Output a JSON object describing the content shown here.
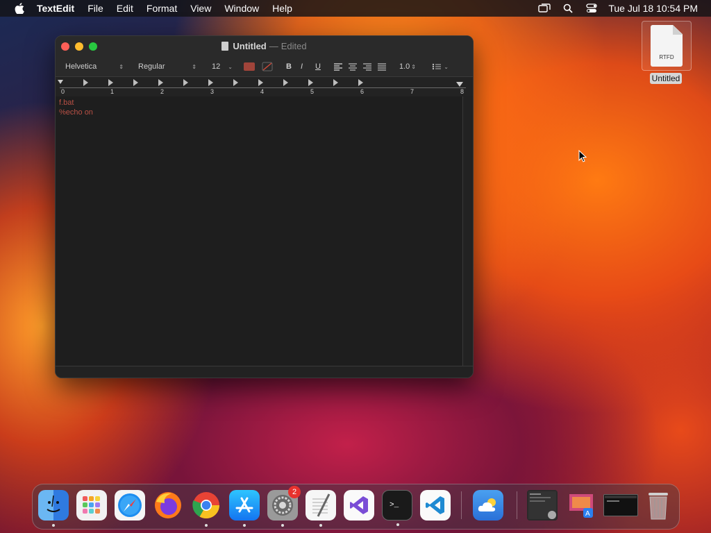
{
  "menubar": {
    "apple_icon": "apple-logo",
    "app_name": "TextEdit",
    "items": [
      "File",
      "Edit",
      "Format",
      "View",
      "Window",
      "Help"
    ],
    "status_icons": [
      "screen-mirroring-icon",
      "search-icon",
      "control-center-icon"
    ],
    "clock": "Tue Jul 18  10:54 PM"
  },
  "desktop": {
    "file_icon": {
      "type_label": "RTFD",
      "name": "Untitled"
    }
  },
  "window": {
    "title": "Untitled",
    "title_separator": "—",
    "title_status": "Edited",
    "toolbar": {
      "font_family": "Helvetica",
      "font_style": "Regular",
      "font_size": "12",
      "text_color": "#a0443a",
      "bold_label": "B",
      "italic_label": "I",
      "underline_label": "U",
      "line_spacing": "1.0"
    },
    "ruler": {
      "numbers": [
        "0",
        "1",
        "2",
        "3",
        "4",
        "5",
        "6",
        "7",
        "8"
      ]
    },
    "content_lines": [
      "f.bat",
      "%echo on"
    ]
  },
  "dock": {
    "apps": [
      {
        "name": "Finder",
        "icon": "finder-icon",
        "running": true
      },
      {
        "name": "Launchpad",
        "icon": "launchpad-icon",
        "running": false
      },
      {
        "name": "Safari",
        "icon": "safari-icon",
        "running": false
      },
      {
        "name": "Firefox",
        "icon": "firefox-icon",
        "running": false
      },
      {
        "name": "Google Chrome",
        "icon": "chrome-icon",
        "running": true
      },
      {
        "name": "App Store",
        "icon": "app-store-icon",
        "running": true
      },
      {
        "name": "System Settings",
        "icon": "system-settings-icon",
        "running": true,
        "badge": "2"
      },
      {
        "name": "TextEdit",
        "icon": "textedit-icon",
        "running": true
      },
      {
        "name": "Visual Studio",
        "icon": "visual-studio-icon",
        "running": false
      },
      {
        "name": "Terminal",
        "icon": "terminal-icon",
        "running": true
      },
      {
        "name": "Visual Studio Code",
        "icon": "vscode-icon",
        "running": false
      },
      {
        "name": "Weather",
        "icon": "weather-icon",
        "running": false
      }
    ],
    "recent": [
      "downloads-stack-icon",
      "applications-stack-icon",
      "window-minimized-icon"
    ],
    "trash_icon": "trash-icon"
  }
}
